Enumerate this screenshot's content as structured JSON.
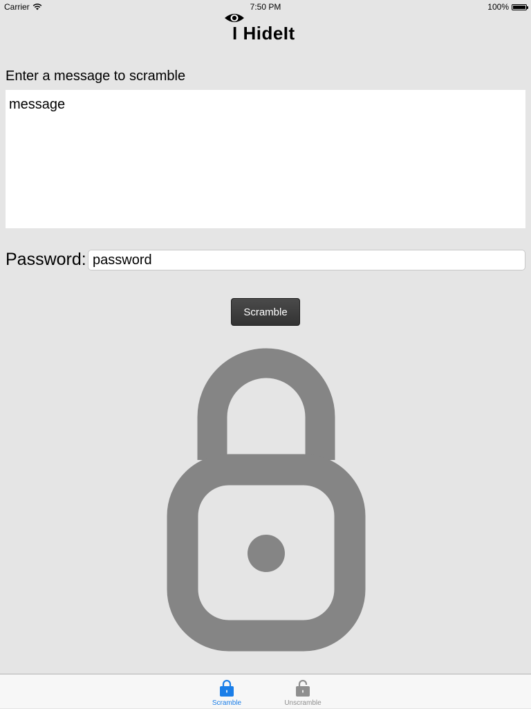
{
  "status_bar": {
    "carrier": "Carrier",
    "time": "7:50 PM",
    "battery": "100%",
    "battery_level": 1.0
  },
  "app": {
    "title": "I HideIt"
  },
  "message": {
    "label": "Enter a message to scramble",
    "value": "message"
  },
  "password": {
    "label": "Password:",
    "value": "password"
  },
  "actions": {
    "scramble_label": "Scramble"
  },
  "tabs": [
    {
      "label": "Scramble",
      "icon": "locked-icon",
      "selected": true
    },
    {
      "label": "Unscramble",
      "icon": "unlocked-icon",
      "selected": false
    }
  ],
  "colors": {
    "background": "#e5e5e5",
    "lock": "#858585",
    "tab_selected": "#1a7ee8",
    "tab_unselected": "#8e8e8e",
    "button": "#3a3a3a"
  }
}
